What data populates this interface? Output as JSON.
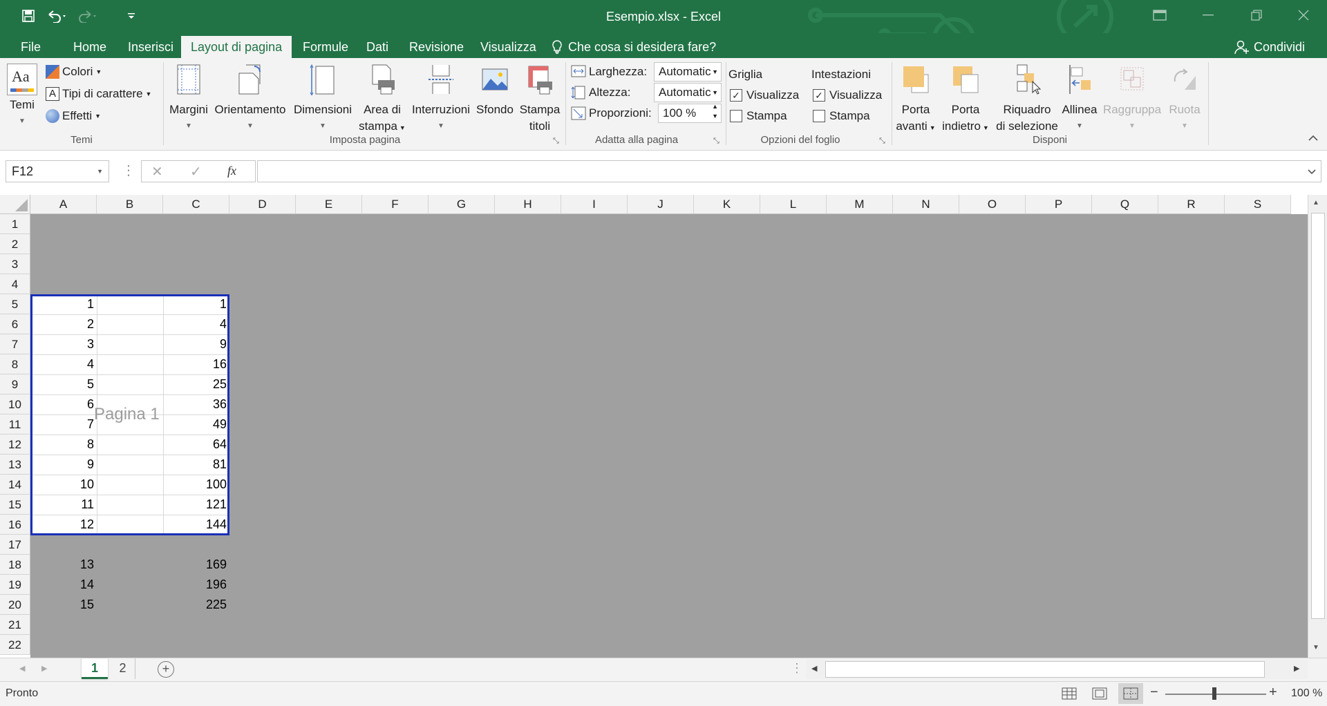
{
  "window": {
    "title": "Esempio.xlsx - Excel"
  },
  "tabs": [
    "File",
    "Home",
    "Inserisci",
    "Layout di pagina",
    "Formule",
    "Dati",
    "Revisione",
    "Visualizza"
  ],
  "tell_me": "Che cosa si desidera fare?",
  "share": "Condividi",
  "ribbon": {
    "temi": {
      "label": "Temi",
      "group": "Temi",
      "colori": "Colori",
      "tipi": "Tipi di carattere",
      "effetti": "Effetti"
    },
    "imposta": {
      "group": "Imposta pagina",
      "margini": "Margini",
      "orientamento": "Orientamento",
      "dimensioni": "Dimensioni",
      "area1": "Area di",
      "area2": "stampa",
      "interruzioni": "Interruzioni",
      "sfondo": "Sfondo",
      "stampa1": "Stampa",
      "stampa2": "titoli"
    },
    "adatta": {
      "group": "Adatta alla pagina",
      "larghezza": "Larghezza:",
      "larghezza_val": "Automatic",
      "altezza": "Altezza:",
      "altezza_val": "Automatic",
      "proporzioni": "Proporzioni:",
      "proporzioni_val": "100 %"
    },
    "opzioni": {
      "group": "Opzioni del foglio",
      "griglia": "Griglia",
      "intestazioni": "Intestazioni",
      "visualizza": "Visualizza",
      "stampa": "Stampa",
      "griglia_visualizza": true,
      "griglia_stampa": false,
      "intest_visualizza": true,
      "intest_stampa": false
    },
    "disponi": {
      "group": "Disponi",
      "avanti1": "Porta",
      "avanti2": "avanti",
      "indietro1": "Porta",
      "indietro2": "indietro",
      "riquadro1": "Riquadro",
      "riquadro2": "di selezione",
      "allinea": "Allinea",
      "raggruppa": "Raggruppa",
      "ruota": "Ruota"
    }
  },
  "formula": {
    "name_box": "F12",
    "content": "",
    "fx": "fx"
  },
  "columns": [
    "A",
    "B",
    "C",
    "D",
    "E",
    "F",
    "G",
    "H",
    "I",
    "J",
    "K",
    "L",
    "M",
    "N",
    "O",
    "P",
    "Q",
    "R",
    "S"
  ],
  "rows": [
    "1",
    "2",
    "3",
    "4",
    "5",
    "6",
    "7",
    "8",
    "9",
    "10",
    "11",
    "12",
    "13",
    "14",
    "15",
    "16",
    "17",
    "18",
    "19",
    "20",
    "21",
    "22"
  ],
  "cells": [
    {
      "row": "5",
      "a": "1",
      "c": "1"
    },
    {
      "row": "6",
      "a": "2",
      "c": "4"
    },
    {
      "row": "7",
      "a": "3",
      "c": "9"
    },
    {
      "row": "8",
      "a": "4",
      "c": "16"
    },
    {
      "row": "9",
      "a": "5",
      "c": "25"
    },
    {
      "row": "10",
      "a": "6",
      "c": "36"
    },
    {
      "row": "11",
      "a": "7",
      "c": "49"
    },
    {
      "row": "12",
      "a": "8",
      "c": "64"
    },
    {
      "row": "13",
      "a": "9",
      "c": "81"
    },
    {
      "row": "14",
      "a": "10",
      "c": "100"
    },
    {
      "row": "15",
      "a": "11",
      "c": "121"
    },
    {
      "row": "16",
      "a": "12",
      "c": "144"
    },
    {
      "row": "18",
      "a": "13",
      "c": "169"
    },
    {
      "row": "19",
      "a": "14",
      "c": "196"
    },
    {
      "row": "20",
      "a": "15",
      "c": "225"
    }
  ],
  "page_watermark": "Pagina 1",
  "sheets": [
    "1",
    "2"
  ],
  "status": {
    "ready": "Pronto",
    "zoom": "100 %"
  },
  "colors": {
    "brand": "#217346",
    "page_break_border": "#1a2fb8",
    "outside_area": "#a0a0a0"
  }
}
